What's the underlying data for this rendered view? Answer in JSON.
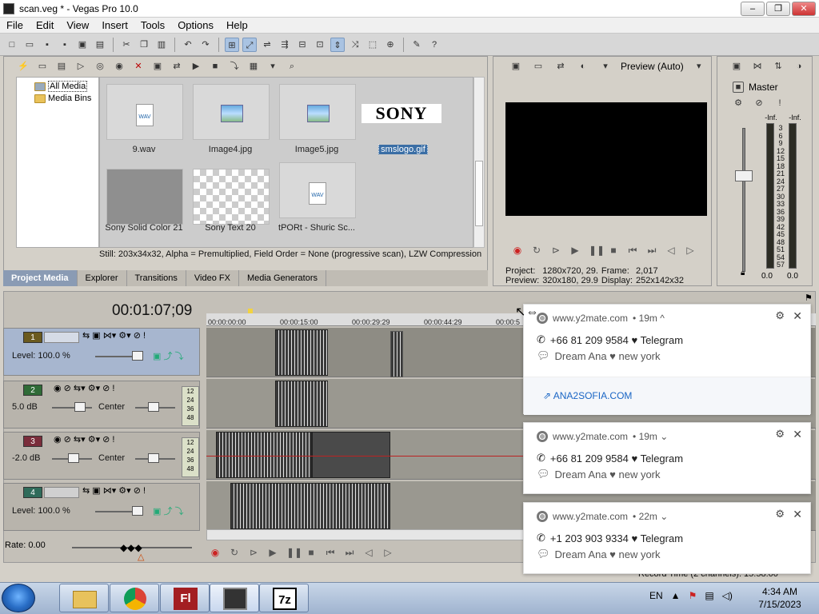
{
  "window": {
    "title": "scan.veg * - Vegas Pro 10.0",
    "min": "–",
    "max": "❐",
    "close": "✕"
  },
  "menu": [
    "File",
    "Edit",
    "View",
    "Insert",
    "Tools",
    "Options",
    "Help"
  ],
  "media": {
    "tree": [
      {
        "label": "All Media"
      },
      {
        "label": "Media Bins"
      }
    ],
    "tiles": [
      {
        "label": "9.wav",
        "kind": "wav"
      },
      {
        "label": "Image4.jpg",
        "kind": "image"
      },
      {
        "label": "Image5.jpg",
        "kind": "image"
      },
      {
        "label": "smslogo.gif",
        "kind": "logo",
        "logo_text": "SONY"
      },
      {
        "label": "Sony Solid Color 21",
        "kind": "solid"
      },
      {
        "label": "Sony Text 20",
        "kind": "checker"
      },
      {
        "label": "tPORt - Shuric Sc...",
        "kind": "wav"
      }
    ],
    "status": "Still: 203x34x32, Alpha = Premultiplied, Field Order = None (progressive scan), LZW Compression",
    "tabs": [
      "Project Media",
      "Explorer",
      "Transitions",
      "Video FX",
      "Media Generators"
    ],
    "wav_tag": "WAV"
  },
  "preview": {
    "mode": "Preview (Auto)",
    "project_label": "Project:",
    "project_value": "1280x720, 29.",
    "frame_label": "Frame:",
    "frame_value": "2,017",
    "preview_label": "Preview:",
    "preview_value": "320x180, 29.9",
    "display_label": "Display:",
    "display_value": "252x142x32"
  },
  "master": {
    "label": "Master",
    "inf_left": "-Inf.",
    "inf_right": "-Inf.",
    "scale": [
      "3",
      "6",
      "9",
      "12",
      "15",
      "18",
      "21",
      "24",
      "27",
      "30",
      "33",
      "36",
      "39",
      "42",
      "45",
      "48",
      "51",
      "54",
      "57"
    ],
    "val_left": "0.0",
    "val_right": "0.0"
  },
  "timeline": {
    "timecode": "00:01:07;09",
    "ruler": [
      "00:00:00:00",
      "00:00:15:00",
      "00:00:29:29",
      "00:00:44:29",
      "00:00:5"
    ],
    "tracks": [
      {
        "num": "1",
        "type": "video",
        "label": "Level: 100.0 %",
        "color": "#6b5a1e"
      },
      {
        "num": "2",
        "type": "audio",
        "label": "5.0 dB",
        "pan": "Center",
        "color": "#2f6b37"
      },
      {
        "num": "3",
        "type": "audio",
        "label": "-2.0 dB",
        "pan": "Center",
        "color": "#7a2d3b"
      },
      {
        "num": "4",
        "type": "video",
        "label": "Level: 100.0 %",
        "color": "#2f6b5a"
      }
    ],
    "meter_scale": [
      "12",
      "24",
      "36",
      "48"
    ],
    "rate": "Rate: 0.00",
    "record_time": "Record Time (2 channels): 15:58:00"
  },
  "notifications": [
    {
      "site": "www.y2mate.com",
      "age": "• 19m ^",
      "line1": "+66 81 209 9584 ♥ Telegram",
      "line2": "Dream Ana ♥ new york",
      "link": "ANA2SOFIA.COM"
    },
    {
      "site": "www.y2mate.com",
      "age": "• 19m ⌄",
      "line1": "+66 81 209 9584 ♥ Telegram",
      "line2": "Dream Ana ♥ new york"
    },
    {
      "site": "www.y2mate.com",
      "age": "• 22m ⌄",
      "line1": "+1 203 903 9334 ♥ Telegram",
      "line2": "Dream Ana ♥ new york"
    }
  ],
  "taskbar": {
    "apps": [
      "folder",
      "chrome",
      "flash",
      "vegas",
      "7zip"
    ],
    "flash_label": "Fl",
    "zip_label": "7z",
    "lang": "EN",
    "time": "4:34 AM",
    "date": "7/15/2023"
  }
}
